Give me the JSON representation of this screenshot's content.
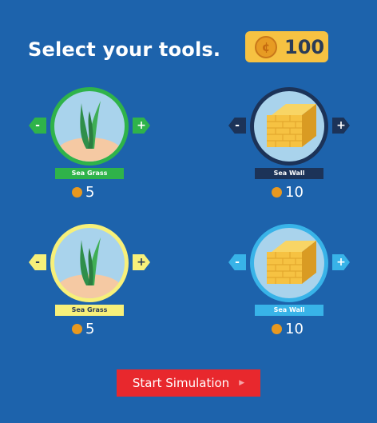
{
  "header": {
    "title": "Select your tools.",
    "coins": "100",
    "coin_icon": "coin-icon"
  },
  "tools": [
    {
      "name": "Sea Grass",
      "cost": "5",
      "minus": "-",
      "plus": "+",
      "icon": "seagrass-icon",
      "color": "#2fb34a"
    },
    {
      "name": "Sea Wall",
      "cost": "10",
      "minus": "-",
      "plus": "+",
      "icon": "seawall-icon",
      "color": "#1c3358"
    },
    {
      "name": "Sea Grass",
      "cost": "5",
      "minus": "-",
      "plus": "+",
      "icon": "seagrass-icon",
      "color": "#f7f07a"
    },
    {
      "name": "Sea Wall",
      "cost": "10",
      "minus": "-",
      "plus": "+",
      "icon": "seawall-icon",
      "color": "#38b3e8"
    }
  ],
  "start_button": {
    "label": "Start Simulation",
    "icon": "play-icon"
  },
  "colors": {
    "background": "#1d63ac",
    "coin_box": "#f6c242",
    "start_button": "#e8282d"
  }
}
